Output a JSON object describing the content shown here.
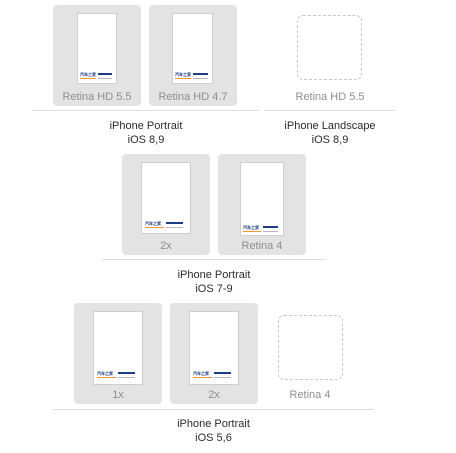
{
  "logo_text": "汽车之家",
  "sections": [
    {
      "id": "ios89-portrait",
      "slots": [
        "Retina HD 5.5",
        "Retina HD 4.7"
      ],
      "title": "iPhone Portrait",
      "subtitle": "iOS 8,9"
    },
    {
      "id": "ios89-landscape",
      "slots": [
        "Retina HD 5.5"
      ],
      "title": "iPhone Landscape",
      "subtitle": "iOS 8,9"
    },
    {
      "id": "ios79-portrait",
      "slots": [
        "2x",
        "Retina 4"
      ],
      "title": "iPhone Portrait",
      "subtitle": "iOS 7-9"
    },
    {
      "id": "ios56-portrait",
      "slots": [
        "1x",
        "2x",
        "Retina 4"
      ],
      "title": "iPhone Portrait",
      "subtitle": "iOS 5,6"
    }
  ],
  "colors": {
    "well": "#e3e3e3",
    "logo_blue": "#1f3c88",
    "logo_orange": "#f2992e"
  }
}
